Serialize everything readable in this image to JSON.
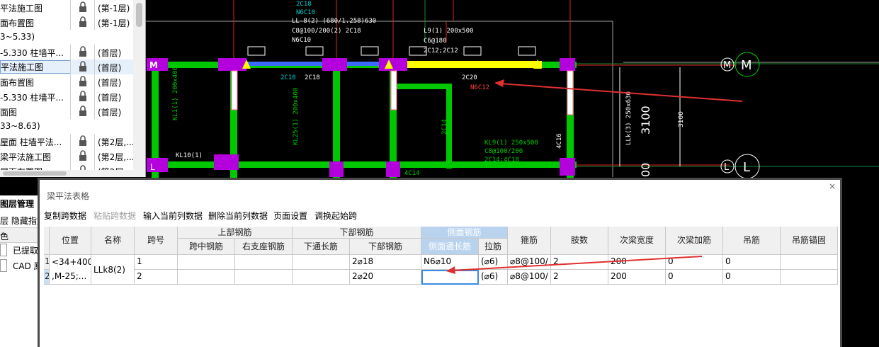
{
  "drawing_list": {
    "rows": [
      {
        "name": "平法施工图",
        "floor": "(第-1层)",
        "selected": false
      },
      {
        "name": "面布置图",
        "floor": "(第-1层)",
        "selected": false
      },
      {
        "group": "3~5.33)"
      },
      {
        "name": "-5.330 柱墙平...",
        "floor": "(首层)",
        "selected": false
      },
      {
        "name": "平法施工图",
        "floor": "(首层)",
        "selected": true
      },
      {
        "name": "面布置图",
        "floor": "(首层)",
        "selected": false
      },
      {
        "name": "-5.330 柱墙平...",
        "floor": "(首层)",
        "selected": false
      },
      {
        "name": "面图",
        "floor": "(首层)",
        "selected": false
      },
      {
        "group": "33~8.63)"
      },
      {
        "name": "屋面 柱墙平法...",
        "floor": "(第2层,...",
        "selected": false
      },
      {
        "name": "梁平法施工图",
        "floor": "(第2层,...",
        "selected": false
      },
      {
        "name": "屋面布置图",
        "floor": "(第2层",
        "selected": false
      }
    ]
  },
  "layer_panel": {
    "title": "图层管理",
    "toolbar": "层  隐藏指定",
    "column": "色",
    "rows": [
      "已提取",
      "CAD 原"
    ]
  },
  "cad": {
    "labels": {
      "beam_top": "LL-8(2) (680/1.258)630",
      "beam_top2": "C8@100/200(2) 2C18",
      "beam_top3": "N6C10",
      "l9": "L9(1) 200x500",
      "l9b": "C6@180",
      "l9c": "2C12;2C12",
      "note_2c20": "2C20",
      "note_n6c12": "N6C12",
      "k2c18": "2C18",
      "k2c18b": "2C18",
      "k2c18top": "2C18",
      "n6c10": "N6C10",
      "kl1": "KL1(1) 200x400",
      "kl10": "KL10(1)",
      "kl25": "KL25(1) 200x400",
      "kl9": "KL9(1) 250x500",
      "kl9b": "C8@100/200",
      "kl9c": "2C14;4C18",
      "c14": "2C14",
      "c14b": "4C14",
      "c14c": "4C14",
      "c16": "4C16",
      "dim3100": "3100",
      "dim3100b": "3100",
      "dim00": "00",
      "axis_m": "M",
      "axis_l": "L",
      "axis_m_small": "M",
      "axis_l_small": "L",
      "llk": "LLk(3) 250x630"
    }
  },
  "dialog": {
    "title": "梁平法表格",
    "close": "×",
    "toolbar": [
      {
        "label": "复制跨数据",
        "enabled": true
      },
      {
        "label": "粘贴跨数据",
        "enabled": false
      },
      {
        "label": "输入当前列数据",
        "enabled": true
      },
      {
        "label": "删除当前列数据",
        "enabled": true
      },
      {
        "label": "页面设置",
        "enabled": true
      },
      {
        "label": "调换起始跨",
        "enabled": true
      }
    ],
    "headers": {
      "position": "位置",
      "name": "名称",
      "span": "跨号",
      "top_rebar": "上部钢筋",
      "top_mid": "跨中钢筋",
      "top_right": "右支座钢筋",
      "bottom_rebar": "下部钢筋",
      "bottom_through": "下通长筋",
      "bottom_bars": "下部钢筋",
      "side_rebar": "侧面钢筋",
      "side_through": "侧面通长筋",
      "side_tie": "拉筋",
      "stirrup": "箍筋",
      "legs": "肢数",
      "sec_width": "次梁宽度",
      "sec_extra": "次梁加筋",
      "hanger": "吊筋",
      "hanger_anchor": "吊筋锚固"
    },
    "rows": [
      {
        "no": "1",
        "position": "<34+400",
        "position2": ",M-25;...",
        "name": "LLk8(2)",
        "span": "1",
        "top_mid": "",
        "top_right": "",
        "bottom_through": "",
        "bottom_bars": "2⌀18",
        "side_through": "N6⌀10",
        "side_tie": "(⌀6)",
        "stirrup": "⌀8@100/",
        "legs": "2",
        "sec_width": "200",
        "sec_extra": "0",
        "hanger": "0",
        "hanger_anchor": ""
      },
      {
        "no": "2",
        "span": "2",
        "top_mid": "",
        "top_right": "",
        "bottom_through": "",
        "bottom_bars": "2⌀20",
        "side_through": "",
        "side_tie": "(⌀6)",
        "stirrup": "⌀8@100/",
        "legs": "2",
        "sec_width": "200",
        "sec_extra": "0",
        "hanger": "0",
        "hanger_anchor": ""
      }
    ]
  },
  "colors": {
    "green": "#00d000",
    "magenta": "#c000e0",
    "yellow": "#ffff00",
    "red": "#ff2020",
    "annotation": "#e03030"
  }
}
